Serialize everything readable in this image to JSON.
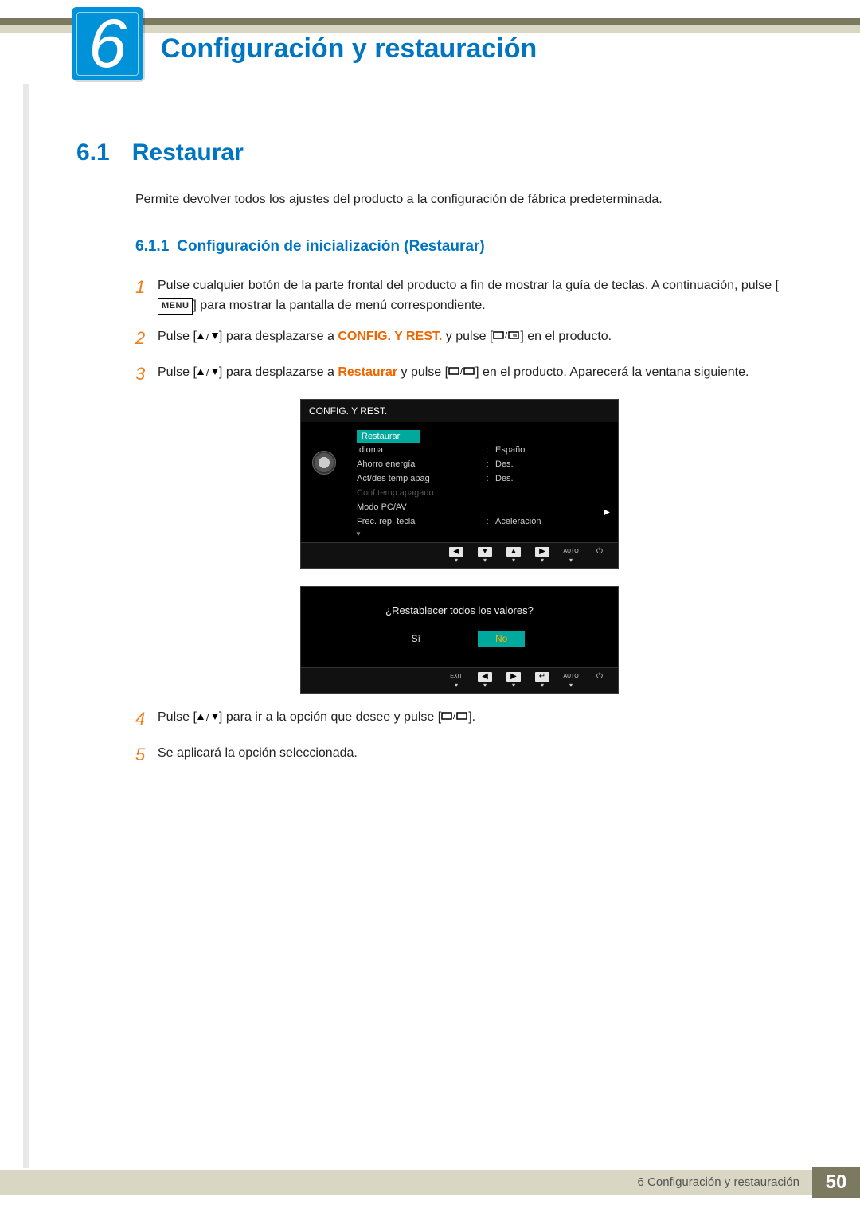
{
  "chapter": {
    "number": "6",
    "title": "Configuración y restauración"
  },
  "section": {
    "number": "6.1",
    "title": "Restaurar"
  },
  "section_desc": "Permite devolver todos los ajustes del producto a la configuración de fábrica predeterminada.",
  "subsection": {
    "number": "6.1.1",
    "title": "Configuración de inicialización (Restaurar)"
  },
  "menu_chip": "MENU",
  "steps": {
    "s1a": "Pulse cualquier botón de la parte frontal del producto a fin de mostrar la guía de teclas. A continuación, pulse [",
    "s1b": "] para mostrar la pantalla de menú correspondiente.",
    "s2a": "Pulse [",
    "s2b": "] para desplazarse a ",
    "s2c": "CONFIG. Y REST.",
    "s2d": " y pulse [",
    "s2e": "] en el producto.",
    "s3a": "Pulse [",
    "s3b": "] para desplazarse a ",
    "s3c": "Restaurar",
    "s3d": " y pulse [",
    "s3e": "] en el producto. Aparecerá la ventana siguiente.",
    "s4a": "Pulse [",
    "s4b": "] para ir a la opción que desee y pulse [",
    "s4c": "].",
    "s5": "Se aplicará la opción seleccionada."
  },
  "osd1": {
    "title": "CONFIG. Y REST.",
    "items": [
      {
        "label": "Restaurar",
        "value": "",
        "hl": true
      },
      {
        "label": "Idioma",
        "value": "Español"
      },
      {
        "label": "Ahorro energía",
        "value": "Des."
      },
      {
        "label": "Act/des temp apag",
        "value": "Des."
      },
      {
        "label": "Conf.temp.apagado",
        "value": "",
        "disabled": true
      },
      {
        "label": "Modo PC/AV",
        "value": "",
        "arrow": true
      },
      {
        "label": "Frec. rep. tecla",
        "value": "Aceleración"
      }
    ],
    "nav": {
      "auto": "AUTO"
    }
  },
  "osd2": {
    "question": "¿Restablecer todos los valores?",
    "yes": "Sí",
    "no": "No",
    "nav": {
      "exit": "EXIT",
      "auto": "AUTO"
    }
  },
  "footer": {
    "text": "6 Configuración y restauración",
    "page": "50"
  }
}
